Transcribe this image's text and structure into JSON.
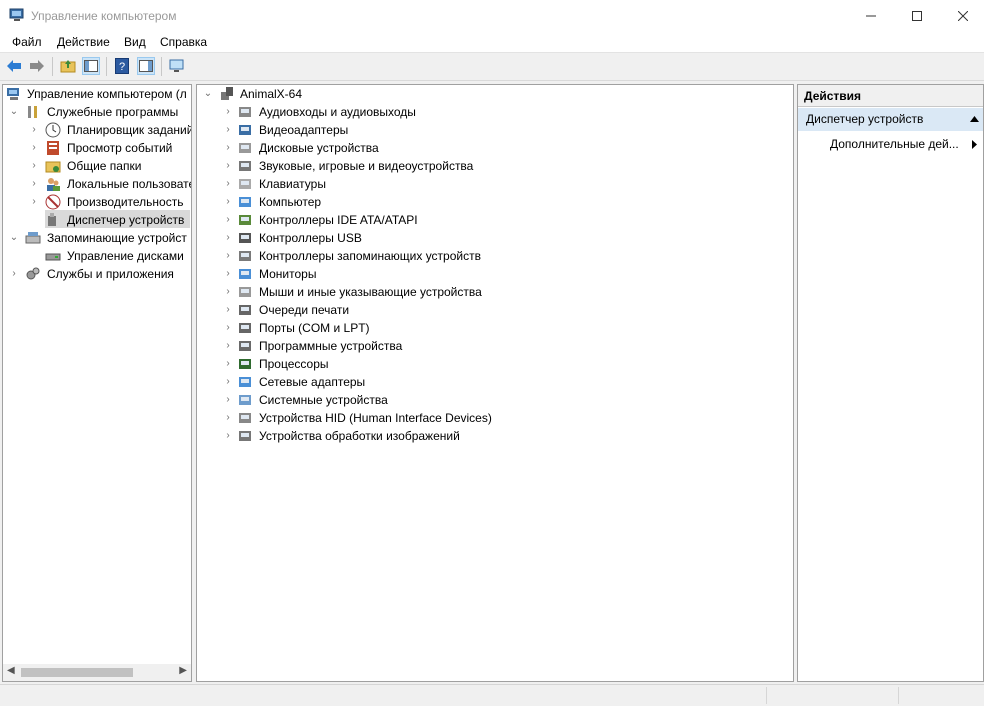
{
  "window": {
    "title": "Управление компьютером"
  },
  "menu": {
    "items": [
      "Файл",
      "Действие",
      "Вид",
      "Справка"
    ]
  },
  "tree": {
    "root": "Управление компьютером (л",
    "items": [
      {
        "label": "Служебные программы",
        "icon": "tools-icon"
      },
      {
        "label": "Планировщик заданий",
        "icon": "clock-icon"
      },
      {
        "label": "Просмотр событий",
        "icon": "event-viewer-icon"
      },
      {
        "label": "Общие папки",
        "icon": "shared-folder-icon"
      },
      {
        "label": "Локальные пользовате",
        "icon": "users-icon"
      },
      {
        "label": "Производительность",
        "icon": "performance-icon"
      },
      {
        "label": "Диспетчер устройств",
        "icon": "device-manager-icon"
      },
      {
        "label": "Запоминающие устройст",
        "icon": "storage-icon"
      },
      {
        "label": "Управление дисками",
        "icon": "disk-management-icon"
      },
      {
        "label": "Службы и приложения",
        "icon": "services-icon"
      }
    ]
  },
  "devices": {
    "computer": "AnimalX-64",
    "categories": [
      "Аудиовходы и аудиовыходы",
      "Видеоадаптеры",
      "Дисковые устройства",
      "Звуковые, игровые и видеоустройства",
      "Клавиатуры",
      "Компьютер",
      "Контроллеры IDE ATA/ATAPI",
      "Контроллеры USB",
      "Контроллеры запоминающих устройств",
      "Мониторы",
      "Мыши и иные указывающие устройства",
      "Очереди печати",
      "Порты (COM и LPT)",
      "Программные устройства",
      "Процессоры",
      "Сетевые адаптеры",
      "Системные устройства",
      "Устройства HID (Human Interface Devices)",
      "Устройства обработки изображений"
    ]
  },
  "actions": {
    "header": "Действия",
    "section": "Диспетчер устройств",
    "more": "Дополнительные дей..."
  },
  "colors": {
    "selection": "#dae8f5",
    "tree_selection": "#d9d9d9",
    "accent": "#0078d7"
  }
}
